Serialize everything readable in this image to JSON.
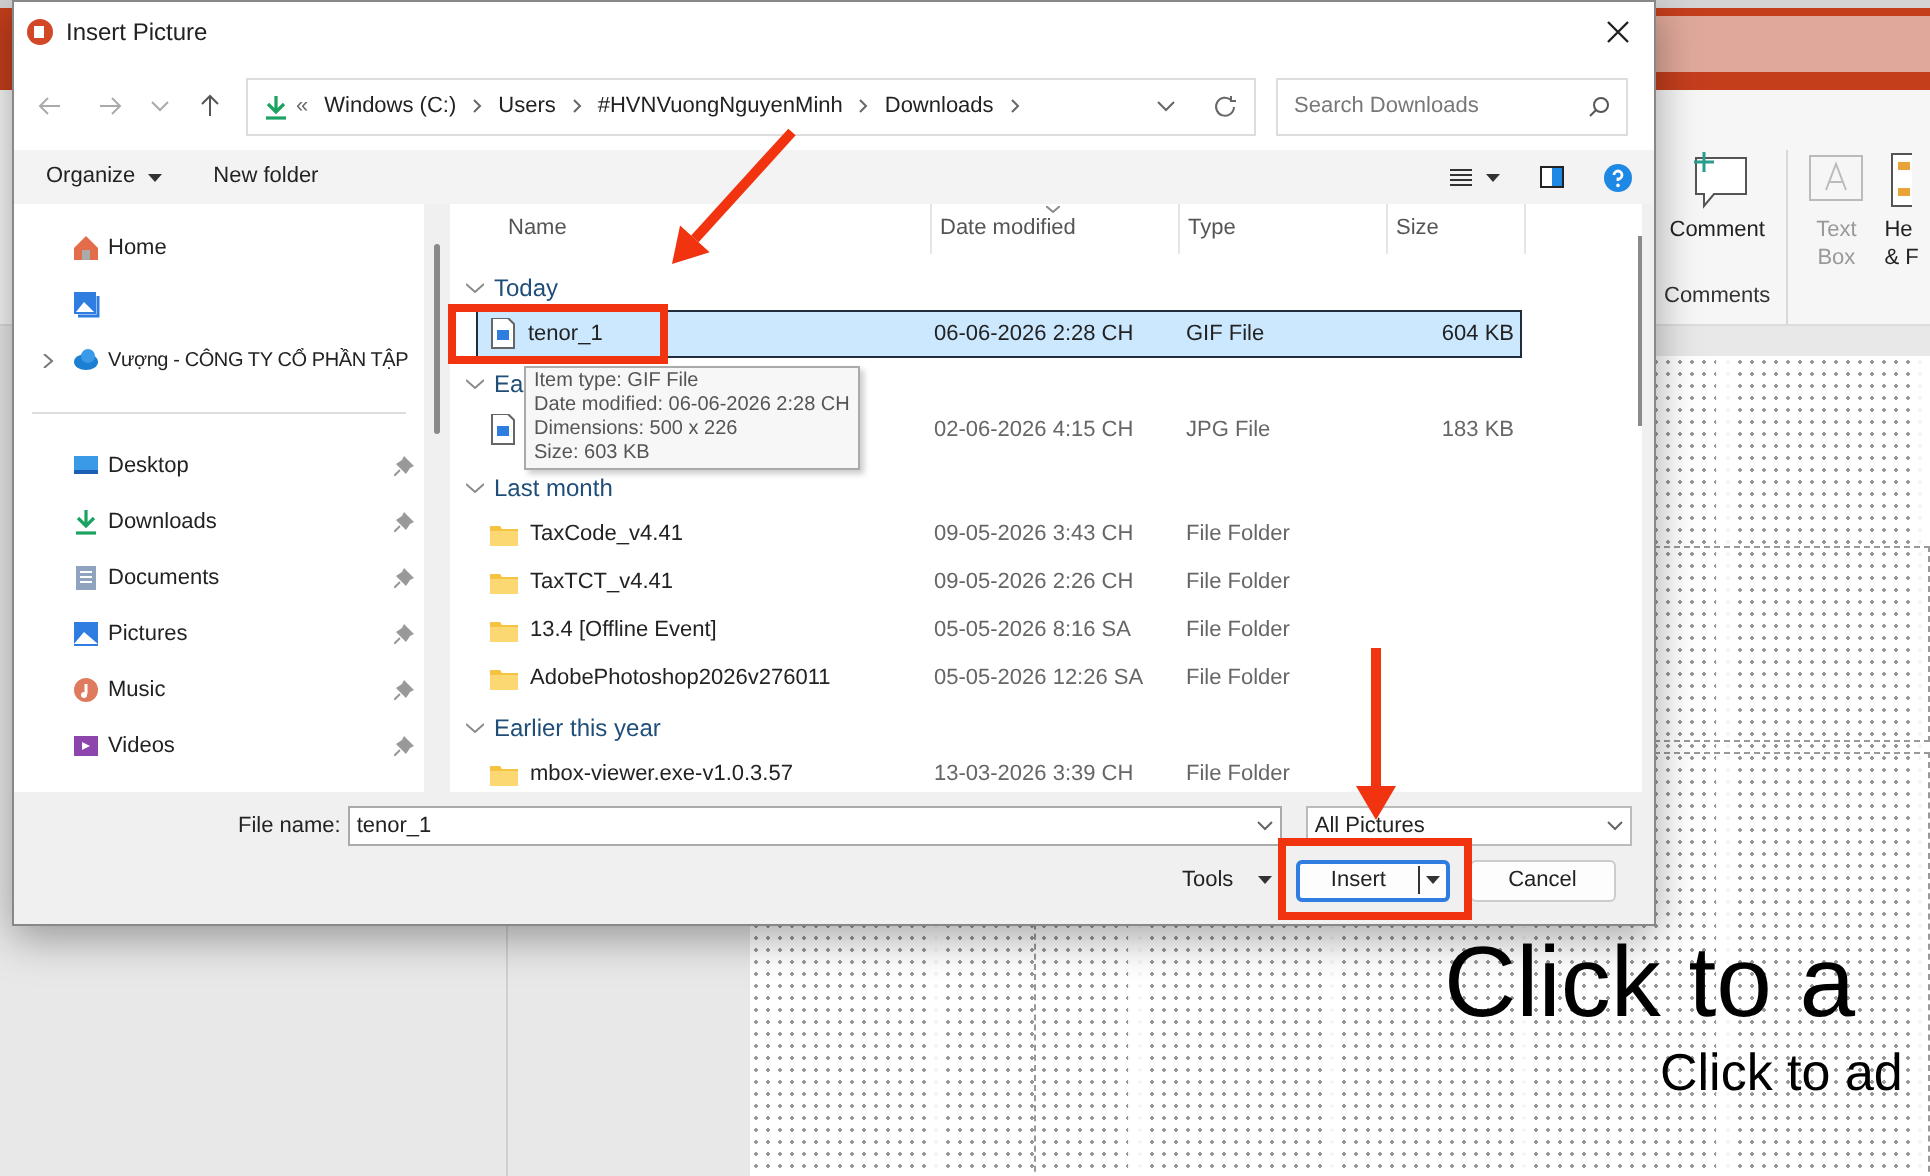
{
  "app": {
    "ribbon": {
      "buttons": [
        {
          "lines": [
            "Comment"
          ],
          "disabled": false,
          "kind": "comment"
        },
        {
          "lines": [
            "Text",
            "Box"
          ],
          "disabled": true,
          "kind": "textbox"
        },
        {
          "lines": [
            "He",
            "& F"
          ],
          "disabled": false,
          "kind": "header"
        }
      ],
      "group_label": "Comments"
    },
    "slide": {
      "title_placeholder": "Click to a",
      "subtitle_placeholder": "Click to ad"
    }
  },
  "dialog": {
    "title": "Insert Picture",
    "address": {
      "overflow": "«",
      "crumbs": [
        "Windows (C:)",
        "Users",
        "#HVNVuongNguyenMinh",
        "Downloads"
      ]
    },
    "search": {
      "placeholder": "Search Downloads"
    },
    "toolbar": [
      "Organize",
      "New folder"
    ],
    "sidebar": [
      {
        "kind": "home",
        "label": "Home",
        "pinned": false
      },
      {
        "kind": "gallery",
        "pinned": false
      },
      {
        "kind": "cloud",
        "label": "Vượng - CÔNG TY CỔ PHẦN TẬP",
        "expanded": false,
        "pinned": false
      },
      {
        "kind": "desktop",
        "label": "Desktop",
        "pinned": true
      },
      {
        "kind": "downloads",
        "label": "Downloads",
        "pinned": true
      },
      {
        "kind": "documents",
        "label": "Documents",
        "pinned": true
      },
      {
        "kind": "pictures",
        "label": "Pictures",
        "pinned": true
      },
      {
        "kind": "music",
        "label": "Music",
        "pinned": true
      },
      {
        "kind": "videos",
        "label": "Videos",
        "pinned": true
      }
    ],
    "columns": [
      "Name",
      "Date modified",
      "Type",
      "Size"
    ],
    "groups": [
      {
        "label": "Today",
        "expanded": true,
        "rows": [
          {
            "kind": "image",
            "name": "tenor_1",
            "date": "06-06-2026 2:28 CH",
            "type": "GIF File",
            "size": "604 KB",
            "selected": true
          }
        ]
      },
      {
        "label": "Ea",
        "expanded": true,
        "rows": [
          {
            "kind": "image",
            "date": "02-06-2026 4:15 CH",
            "type": "JPG File",
            "size": "183 KB",
            "selected": false
          }
        ]
      },
      {
        "label": "Last month",
        "expanded": true,
        "rows": [
          {
            "kind": "folder",
            "name": "TaxCode_v4.41",
            "date": "09-05-2026 3:43 CH",
            "type": "File Folder",
            "selected": false
          },
          {
            "kind": "folder",
            "name": "TaxTCT_v4.41",
            "date": "09-05-2026 2:26 CH",
            "type": "File Folder",
            "selected": false
          },
          {
            "kind": "folder",
            "name": "13.4 [Offline Event]",
            "date": "05-05-2026 8:16 SA",
            "type": "File Folder",
            "selected": false
          },
          {
            "kind": "folder",
            "name": "AdobePhotoshop2026v276011",
            "date": "05-05-2026 12:26 SA",
            "type": "File Folder",
            "selected": false
          }
        ]
      },
      {
        "label": "Earlier this year",
        "expanded": true,
        "rows": [
          {
            "kind": "folder",
            "name": "mbox-viewer.exe-v1.0.3.57",
            "date": "13-03-2026 3:39 CH",
            "type": "File Folder",
            "selected": false
          }
        ]
      }
    ],
    "tooltip": [
      "Item type: GIF File",
      "Date modified: 06-06-2026 2:28 CH",
      "Dimensions: 500 x 226",
      "Size: 603 KB"
    ],
    "file_name": {
      "label": "File name:",
      "value": "tenor_1"
    },
    "file_type": {
      "value": "All Pictures"
    },
    "tools": "Tools",
    "buttons": [
      {
        "label": "Insert",
        "kind": "split",
        "default": true
      },
      {
        "label": "Cancel",
        "kind": "plain",
        "default": false
      }
    ]
  },
  "annotations": [
    {
      "kind": "arrow"
    },
    {
      "kind": "frame"
    },
    {
      "kind": "arrow"
    },
    {
      "kind": "frame"
    }
  ]
}
